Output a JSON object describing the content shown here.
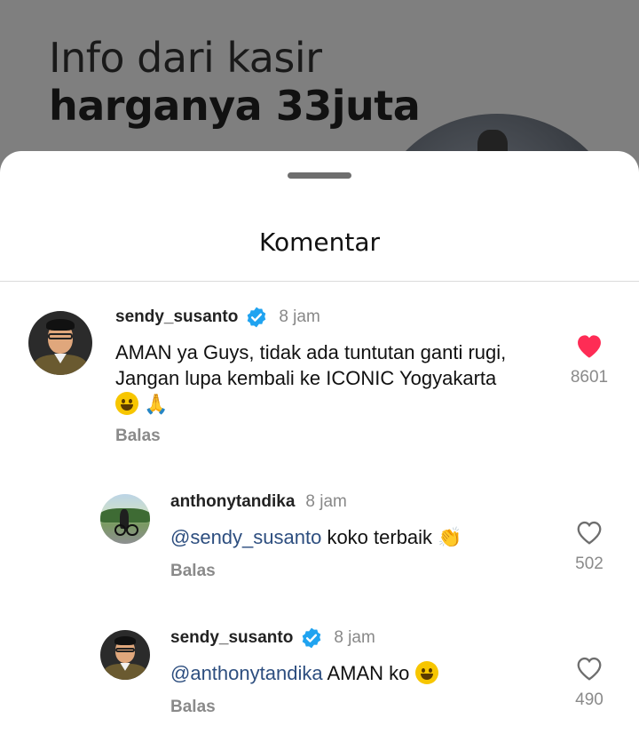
{
  "background_post": {
    "line1": "Info dari kasir",
    "line2": "harganya 33juta"
  },
  "sheet": {
    "title": "Komentar"
  },
  "comments": [
    {
      "username": "sendy_susanto",
      "verified": true,
      "time": "8 jam",
      "text_line1": "AMAN ya Guys, tidak ada tuntutan ganti rugi,",
      "text_line2": "Jangan lupa kembali ke ICONIC Yogyakarta",
      "emoji1": "😀",
      "emoji2": "🙏",
      "reply_label": "Balas",
      "liked": true,
      "like_count": "8601"
    },
    {
      "username": "anthonytandika",
      "verified": false,
      "time": "8 jam",
      "mention": "@sendy_susanto",
      "text": " koko terbaik ",
      "emoji": "👏",
      "reply_label": "Balas",
      "liked": false,
      "like_count": "502"
    },
    {
      "username": "sendy_susanto",
      "verified": true,
      "time": "8 jam",
      "mention": "@anthonytandika",
      "text": " AMAN ko ",
      "emoji": "😀",
      "reply_label": "Balas",
      "liked": false,
      "like_count": "490"
    }
  ],
  "colors": {
    "like_red": "#fe2c55",
    "verified_blue": "#20a3f0",
    "mention_blue": "#2d4e7f"
  },
  "icons": {
    "verified": "verified-badge-icon",
    "heart_filled": "heart-filled-icon",
    "heart_outline": "heart-outline-icon"
  }
}
